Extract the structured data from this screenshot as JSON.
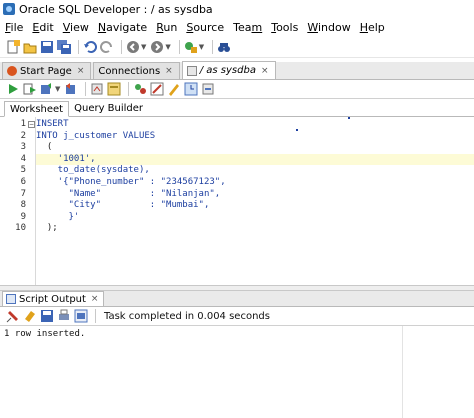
{
  "window": {
    "title": "Oracle SQL Developer : / as sysdba"
  },
  "menu": [
    "File",
    "Edit",
    "View",
    "Navigate",
    "Run",
    "Source",
    "Team",
    "Tools",
    "Window",
    "Help"
  ],
  "menu_mnemonic": [
    "F",
    "E",
    "V",
    "N",
    "R",
    "S",
    "m",
    "T",
    "W",
    "H"
  ],
  "doc_tabs": [
    {
      "label": "Start Page"
    },
    {
      "label": "Connections"
    },
    {
      "label": "/ as sysdba"
    }
  ],
  "sub_tabs": [
    "Worksheet",
    "Query Builder"
  ],
  "editor": {
    "line_numbers": [
      "1",
      "2",
      "3",
      "4",
      "5",
      "6",
      "7",
      "8",
      "9",
      "10"
    ],
    "lines": [
      "INSERT",
      "INTO j_customer VALUES",
      "  (",
      "    '1001',",
      "    to_date(sysdate),",
      "    '{\"Phone_number\" : \"234567123\",",
      "      \"Name\"         : \"Nilanjan\",",
      "      \"City\"         : \"Mumbai\",",
      "      }'",
      "  );"
    ]
  },
  "output": {
    "tab_label": "Script Output",
    "status": "Task completed in 0.004 seconds",
    "text": "1 row inserted."
  },
  "icons": {
    "toolbar": [
      "new-icon",
      "open-icon",
      "save-icon",
      "save-all-icon",
      "undo-icon",
      "redo-icon",
      "back-icon",
      "forward-icon",
      "run-config-icon",
      "binoculars-icon"
    ],
    "editor_toolbar": [
      "run-statement-icon",
      "run-script-icon",
      "commit-icon",
      "rollback-icon",
      "autotrace-icon",
      "explain-plan-icon",
      "sql-tuning-icon",
      "clear-icon",
      "format-icon",
      "history-icon",
      "unshared-icon"
    ],
    "output_toolbar": [
      "pin-icon",
      "eraser-icon",
      "save-output-icon",
      "print-icon",
      "export-icon"
    ]
  },
  "colors": {
    "keyword": "#1d3fa0",
    "current_line": "#fdfbd6"
  }
}
